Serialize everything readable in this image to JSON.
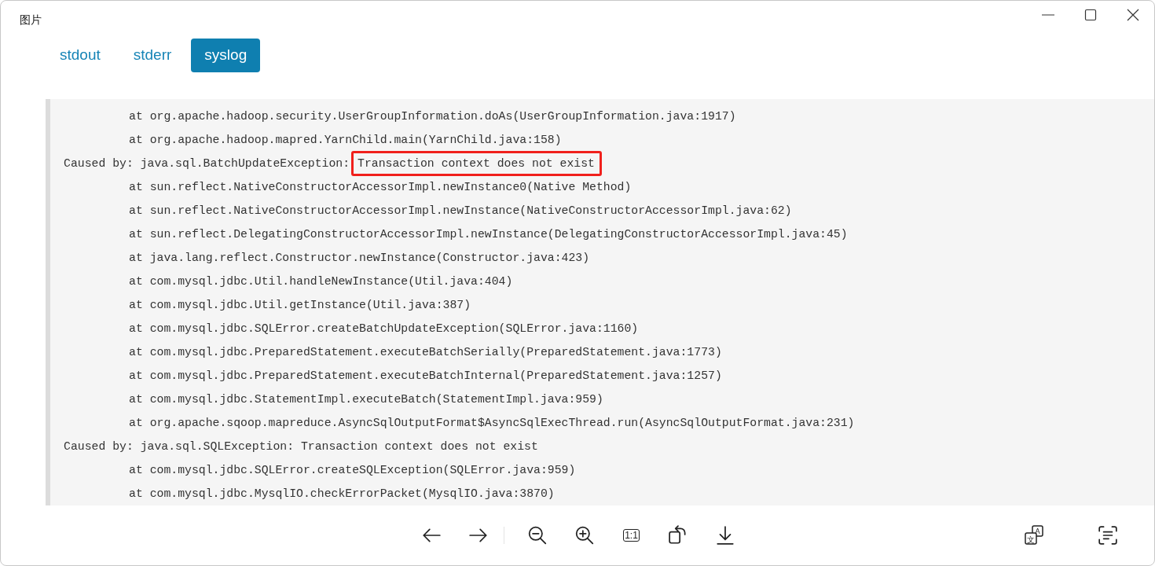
{
  "window": {
    "title": "图片"
  },
  "tabs": [
    {
      "label": "stdout",
      "selected": false
    },
    {
      "label": "stderr",
      "selected": false
    },
    {
      "label": "syslog",
      "selected": true
    }
  ],
  "log": {
    "lines": [
      {
        "kind": "frame",
        "text": "at org.apache.hadoop.security.UserGroupInformation.doAs(UserGroupInformation.java:1917)"
      },
      {
        "kind": "frame",
        "text": "at org.apache.hadoop.mapred.YarnChild.main(YarnChild.java:158)"
      },
      {
        "kind": "cause",
        "text": "Caused by: java.sql.BatchUpdateException:",
        "highlight": "Transaction context does not exist"
      },
      {
        "kind": "frame",
        "text": "at sun.reflect.NativeConstructorAccessorImpl.newInstance0(Native Method)"
      },
      {
        "kind": "frame",
        "text": "at sun.reflect.NativeConstructorAccessorImpl.newInstance(NativeConstructorAccessorImpl.java:62)"
      },
      {
        "kind": "frame",
        "text": "at sun.reflect.DelegatingConstructorAccessorImpl.newInstance(DelegatingConstructorAccessorImpl.java:45)"
      },
      {
        "kind": "frame",
        "text": "at java.lang.reflect.Constructor.newInstance(Constructor.java:423)"
      },
      {
        "kind": "frame",
        "text": "at com.mysql.jdbc.Util.handleNewInstance(Util.java:404)"
      },
      {
        "kind": "frame",
        "text": "at com.mysql.jdbc.Util.getInstance(Util.java:387)"
      },
      {
        "kind": "frame",
        "text": "at com.mysql.jdbc.SQLError.createBatchUpdateException(SQLError.java:1160)"
      },
      {
        "kind": "frame",
        "text": "at com.mysql.jdbc.PreparedStatement.executeBatchSerially(PreparedStatement.java:1773)"
      },
      {
        "kind": "frame",
        "text": "at com.mysql.jdbc.PreparedStatement.executeBatchInternal(PreparedStatement.java:1257)"
      },
      {
        "kind": "frame",
        "text": "at com.mysql.jdbc.StatementImpl.executeBatch(StatementImpl.java:959)"
      },
      {
        "kind": "frame",
        "text": "at org.apache.sqoop.mapreduce.AsyncSqlOutputFormat$AsyncSqlExecThread.run(AsyncSqlOutputFormat.java:231)"
      },
      {
        "kind": "cause",
        "text": "Caused by: java.sql.SQLException: Transaction context does not exist"
      },
      {
        "kind": "frame",
        "text": "at com.mysql.jdbc.SQLError.createSQLException(SQLError.java:959)"
      },
      {
        "kind": "frame",
        "text": "at com.mysql.jdbc.MysqlIO.checkErrorPacket(MysqlIO.java:3870)"
      }
    ]
  },
  "toolbar": {
    "navigation": [
      {
        "kind": "back"
      },
      {
        "kind": "forward"
      }
    ],
    "tools": [
      {
        "kind": "zoom-out"
      },
      {
        "kind": "zoom-in"
      },
      {
        "kind": "actual-size",
        "label": "1:1"
      },
      {
        "kind": "rotate"
      },
      {
        "kind": "download"
      }
    ],
    "extras": [
      {
        "kind": "translate",
        "glyphs": [
          "文",
          "A"
        ]
      },
      {
        "kind": "text-scan"
      }
    ]
  }
}
